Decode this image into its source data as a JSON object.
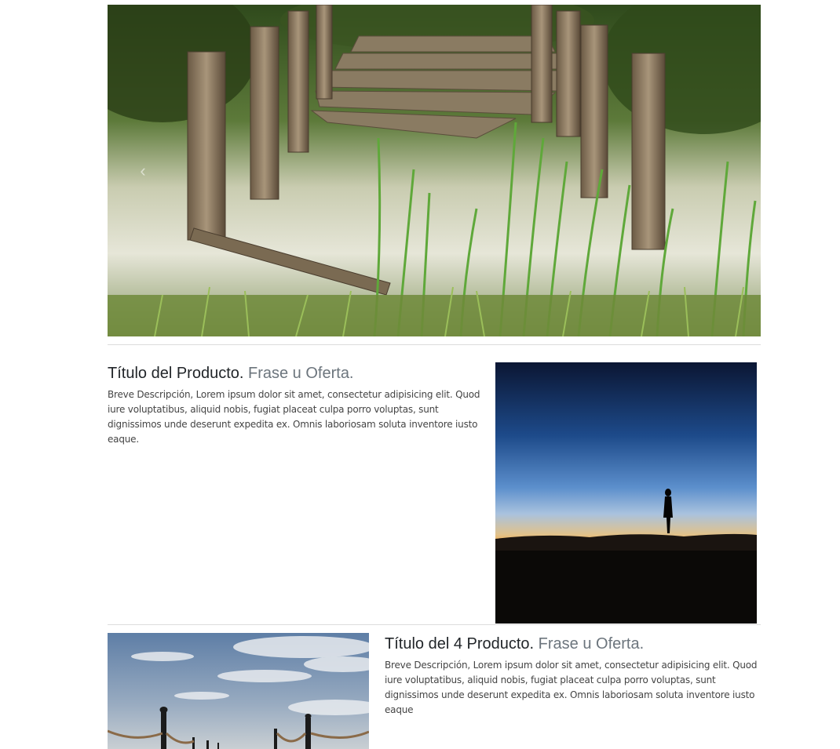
{
  "carousel": {
    "image": "landscape-dock-photo",
    "prev_icon": "chevron-left-icon",
    "prev_glyph": "‹"
  },
  "features": [
    {
      "title": "Título del Producto.",
      "subtitle": "Frase u Oferta.",
      "description": "Breve Descripción, Lorem ipsum dolor sit amet, consectetur adipisicing elit. Quod iure voluptatibus, aliquid nobis, fugiat placeat culpa porro voluptas, sunt dignissimos unde deserunt expedita ex. Omnis laboriosam soluta inventore iusto eaque.",
      "image": "sunset-silhouette-photo"
    },
    {
      "title": "Título del 4 Producto.",
      "subtitle": "Frase u Oferta.",
      "description": "Breve Descripción, Lorem ipsum dolor sit amet, consectetur adipisicing elit. Quod iure voluptatibus, aliquid nobis, fugiat placeat culpa porro voluptas, sunt dignissimos unde deserunt expedita ex. Omnis laboriosam soluta inventore iusto eaque",
      "image": "sky-rope-fence-photo"
    }
  ]
}
